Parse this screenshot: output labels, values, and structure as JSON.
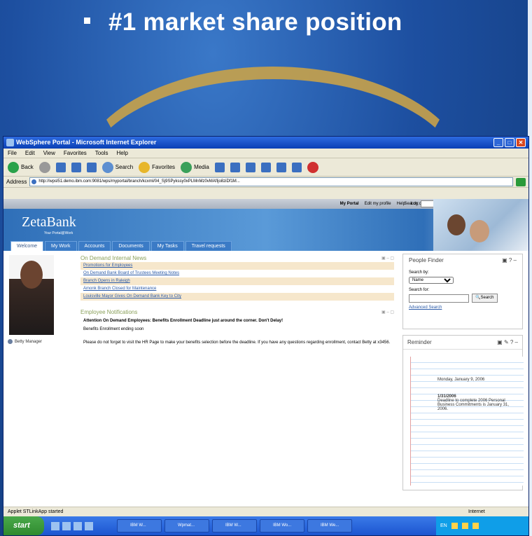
{
  "slide": {
    "bullet": "#1 market share position"
  },
  "window": {
    "title": "WebSphere Portal - Microsoft Internet Explorer"
  },
  "menu": [
    "File",
    "Edit",
    "View",
    "Favorites",
    "Tools",
    "Help"
  ],
  "toolbar": {
    "back": "Back",
    "search": "Search",
    "favorites": "Favorites",
    "media": "Media"
  },
  "address": {
    "label": "Address",
    "url": "http://wpsl51.demo.ibm.com:9081/wps/myportal/branch/kcxml/04_Sj9SPykssy0xPLMnMz0vMAfIjo8ziDf1M..."
  },
  "portal": {
    "top_links": [
      "My Portal",
      "Edit my profile",
      "Help",
      "Log out"
    ],
    "search_label": "Search:",
    "logo": "ZetaBank",
    "logo_sub": "Your Portal@Work",
    "tabs": [
      "Welcome",
      "My Work",
      "Accounts",
      "Documents",
      "My Tasks",
      "Travel requests"
    ],
    "user": "Betty Manager",
    "news_title": "On Demand Internal News",
    "news": [
      "Promotions for Employees",
      "On Demand Bank Board of Trustees Meeting Notes",
      "Branch Opens in Raleigh",
      "Amonk Branch Closed for Maintenance",
      "Louisville Mayor Gives On Demand Bank Key to City"
    ],
    "notif_title": "Employee Notifications",
    "notif_headline": "Attention On Demand Employees: Benefits Enrollment Deadline just around the corner. Don't Delay!",
    "notif_line": "Benefits Enrollment ending soon",
    "notif_para": "Please do not forget to visit the HR Page to make your benefits selection before the deadline.  If you have any questions regarding enrollment, contact Betty at x3456.",
    "finder": {
      "title": "People Finder",
      "search_by": "Search by:",
      "select_value": "Name",
      "search_for": "Search for:",
      "button": "Search",
      "advanced": "Advanced Search"
    },
    "reminder": {
      "title": "Reminder",
      "date": "Monday, January 9, 2006",
      "item_date": "1/31/2006",
      "item_text": "Deadline to complete 2006 Personal Business Commitments is January 31, 2006."
    }
  },
  "status": {
    "left": "Applet STLinkApp started",
    "zone": "Internet"
  },
  "taskbar": {
    "start": "start",
    "tasks": [
      "IBM W...",
      "Wpmat...",
      "IBM W...",
      "IBM Wo...",
      "IBM We..."
    ],
    "tray_text": "EN"
  }
}
